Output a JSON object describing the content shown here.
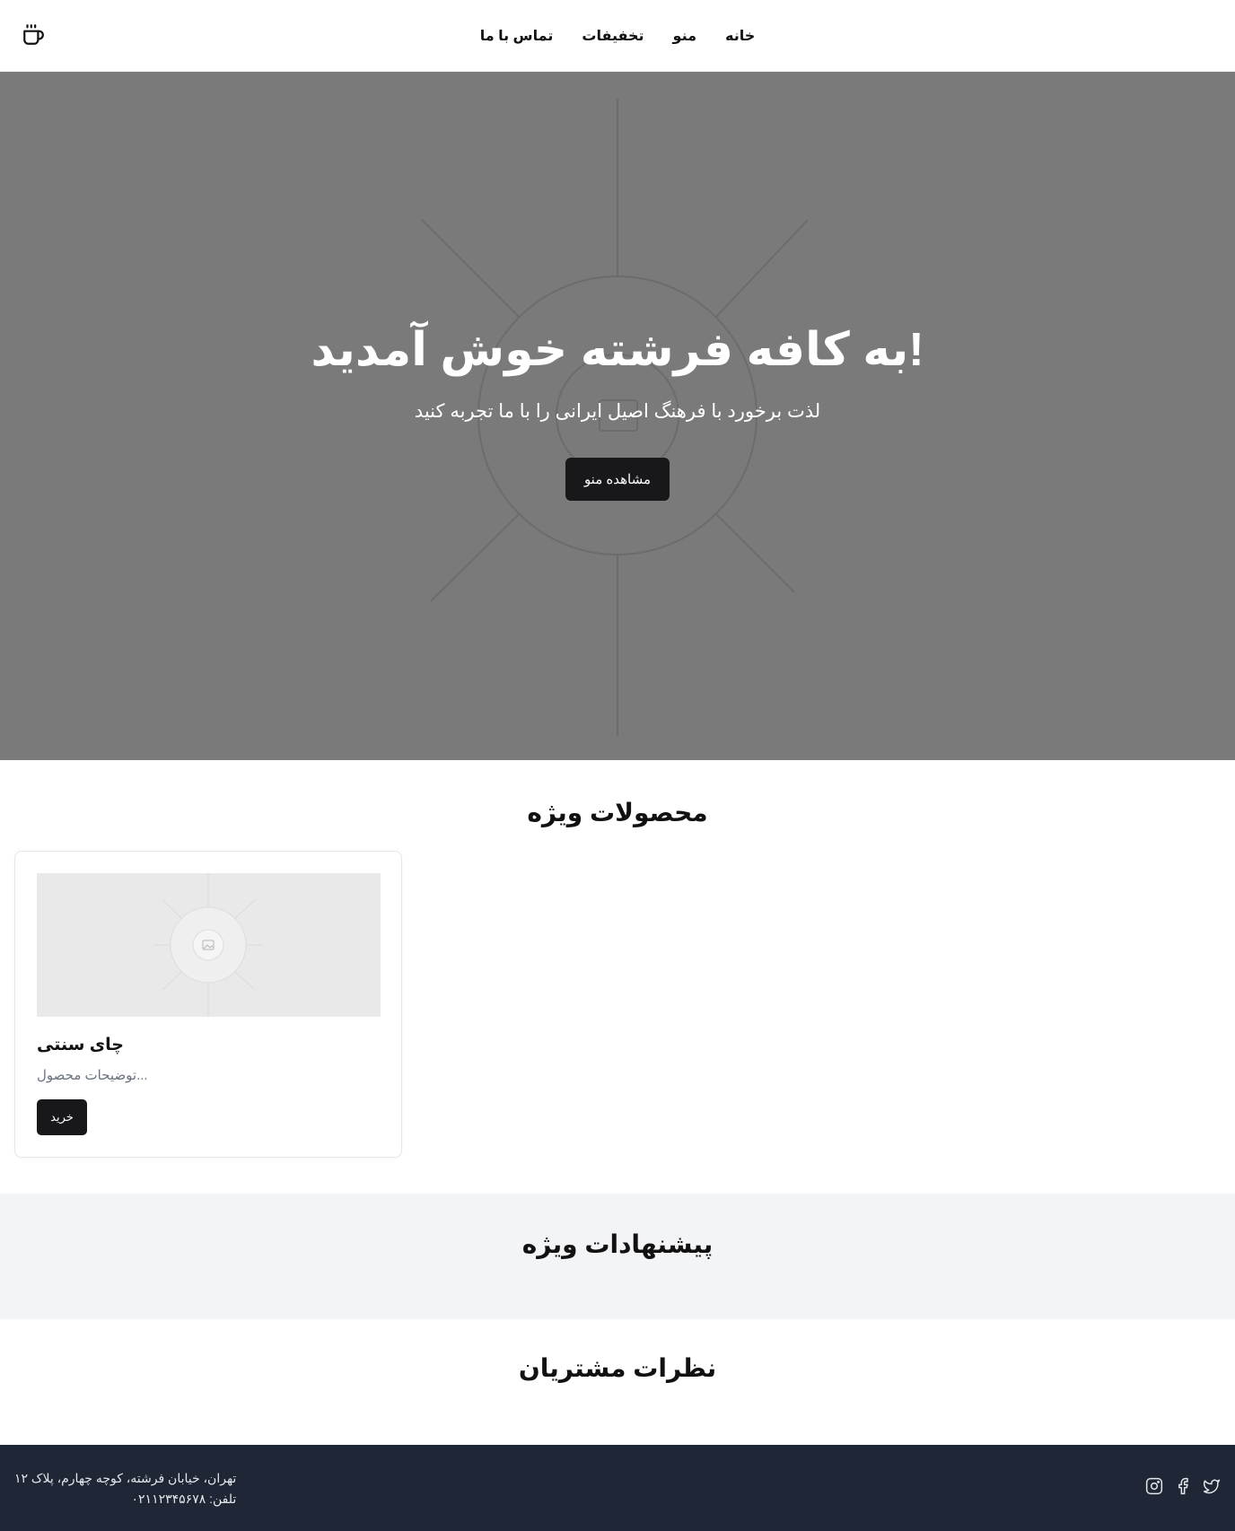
{
  "header": {
    "logo_icon": "coffee-cup-icon",
    "nav": [
      {
        "label": "خانه"
      },
      {
        "label": "منو"
      },
      {
        "label": "تخفیفات"
      },
      {
        "label": "تماس با ما"
      }
    ]
  },
  "hero": {
    "title": "!به کافه فرشته خوش آمدید",
    "subtitle": "لذت برخورد با فرهنگ اصیل ایرانی را با ما تجربه کنید",
    "cta_label": "مشاهده منو",
    "background_color": "#7a7a7a"
  },
  "products": {
    "title": "محصولات ویژه",
    "items": [
      {
        "name": "چای سنتی",
        "description": "...توضیحات محصول",
        "buy_label": "خرید"
      }
    ]
  },
  "offers": {
    "title": "پیشنهادات ویژه"
  },
  "reviews": {
    "title": "نظرات مشتریان"
  },
  "footer": {
    "address": "تهران، خیابان فرشته، کوچه چهارم، پلاک ۱۲",
    "phone": "تلفن: ۰۲۱۱۲۳۴۵۶۷۸",
    "social": [
      "twitter-icon",
      "facebook-icon",
      "instagram-icon"
    ],
    "background_color": "#1f2737"
  },
  "colors": {
    "button_dark": "#18181b",
    "section_alt": "#f3f4f6"
  }
}
